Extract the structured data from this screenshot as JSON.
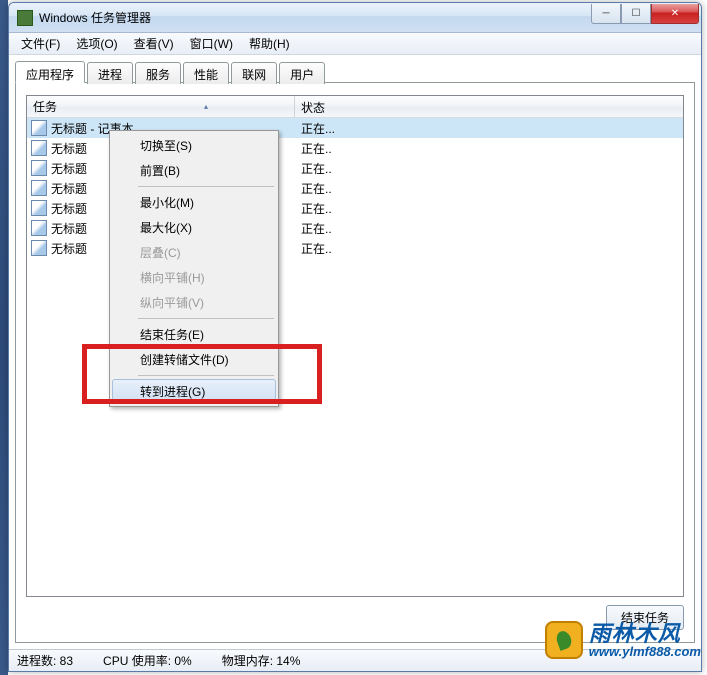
{
  "window": {
    "title": "Windows 任务管理器"
  },
  "menubar": {
    "file": "文件(F)",
    "options": "选项(O)",
    "view": "查看(V)",
    "windows": "窗口(W)",
    "help": "帮助(H)"
  },
  "tabs": {
    "applications": "应用程序",
    "processes": "进程",
    "services": "服务",
    "performance": "性能",
    "networking": "联网",
    "users": "用户"
  },
  "columns": {
    "task": "任务",
    "status": "状态"
  },
  "rows": [
    {
      "task": "无标题 - 记事本",
      "status": "正在..."
    },
    {
      "task": "无标题",
      "status": "正在.."
    },
    {
      "task": "无标题",
      "status": "正在.."
    },
    {
      "task": "无标题",
      "status": "正在.."
    },
    {
      "task": "无标题",
      "status": "正在.."
    },
    {
      "task": "无标题",
      "status": "正在.."
    },
    {
      "task": "无标题",
      "status": "正在.."
    }
  ],
  "context_menu": {
    "switch_to": "切换至(S)",
    "bring_front": "前置(B)",
    "minimize": "最小化(M)",
    "maximize": "最大化(X)",
    "cascade": "层叠(C)",
    "tile_h": "横向平铺(H)",
    "tile_v": "纵向平铺(V)",
    "end_task": "结束任务(E)",
    "create_dump": "创建转储文件(D)",
    "go_to_process": "转到进程(G)"
  },
  "buttons": {
    "end_task": "结束任务"
  },
  "statusbar": {
    "processes": "进程数: 83",
    "cpu": "CPU 使用率: 0%",
    "memory": "物理内存: 14%"
  },
  "watermark": {
    "name": "雨林木风",
    "url": "www.ylmf888.com"
  }
}
